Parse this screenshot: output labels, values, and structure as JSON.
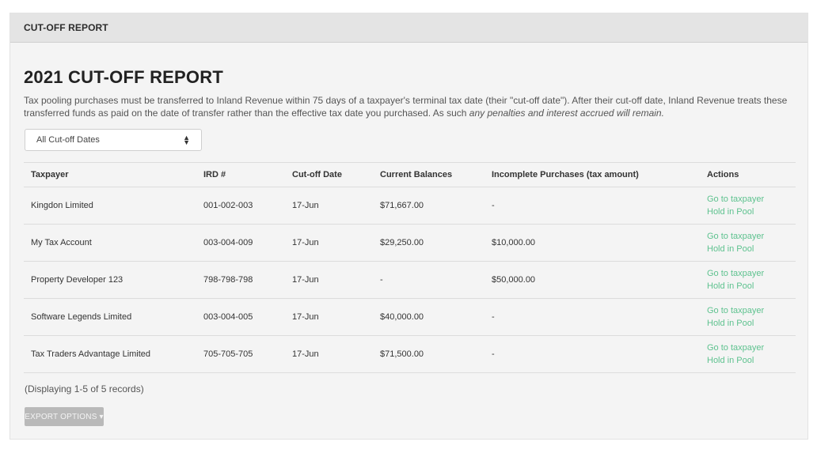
{
  "header": {
    "title": "CUT-OFF REPORT"
  },
  "report": {
    "title": "2021 CUT-OFF REPORT",
    "description_main": "Tax pooling purchases must be transferred to Inland Revenue within 75 days of a taxpayer's terminal tax date (their \"cut-off date\"). After their cut-off date, Inland Revenue treats these transferred funds as paid on the date of transfer rather than the effective tax date you purchased. As such ",
    "description_emphasis": "any penalties and interest accrued will remain."
  },
  "filter": {
    "selected": "All Cut-off Dates",
    "arrows_icon": "sort-arrows-icon"
  },
  "table": {
    "headers": {
      "taxpayer": "Taxpayer",
      "ird": "IRD #",
      "cutoff": "Cut-off Date",
      "balances": "Current Balances",
      "incomplete": "Incomplete Purchases (tax amount)",
      "actions": "Actions"
    },
    "rows": [
      {
        "taxpayer": "Kingdon Limited",
        "ird": "001-002-003",
        "cutoff": "17-Jun",
        "balance": "$71,667.00",
        "incomplete": "-",
        "action1": "Go to taxpayer",
        "action2": "Hold in Pool"
      },
      {
        "taxpayer": "My Tax Account",
        "ird": "003-004-009",
        "cutoff": "17-Jun",
        "balance": "$29,250.00",
        "incomplete": "$10,000.00",
        "action1": "Go to taxpayer",
        "action2": "Hold in Pool"
      },
      {
        "taxpayer": "Property Developer 123",
        "ird": "798-798-798",
        "cutoff": "17-Jun",
        "balance": "-",
        "incomplete": "$50,000.00",
        "action1": "Go to taxpayer",
        "action2": "Hold in Pool"
      },
      {
        "taxpayer": "Software Legends Limited",
        "ird": "003-004-005",
        "cutoff": "17-Jun",
        "balance": "$40,000.00",
        "incomplete": "-",
        "action1": "Go to taxpayer",
        "action2": "Hold in Pool"
      },
      {
        "taxpayer": "Tax Traders Advantage Limited",
        "ird": "705-705-705",
        "cutoff": "17-Jun",
        "balance": "$71,500.00",
        "incomplete": "-",
        "action1": "Go to taxpayer",
        "action2": "Hold in Pool"
      }
    ]
  },
  "footer": {
    "records": "(Displaying 1-5 of 5 records)",
    "export_label": "EXPORT OPTIONS ▾"
  },
  "colors": {
    "link": "#5ec28f",
    "header_bg": "#e4e4e4",
    "panel_bg": "#f4f4f4",
    "button_bg": "#b9b9b9"
  }
}
